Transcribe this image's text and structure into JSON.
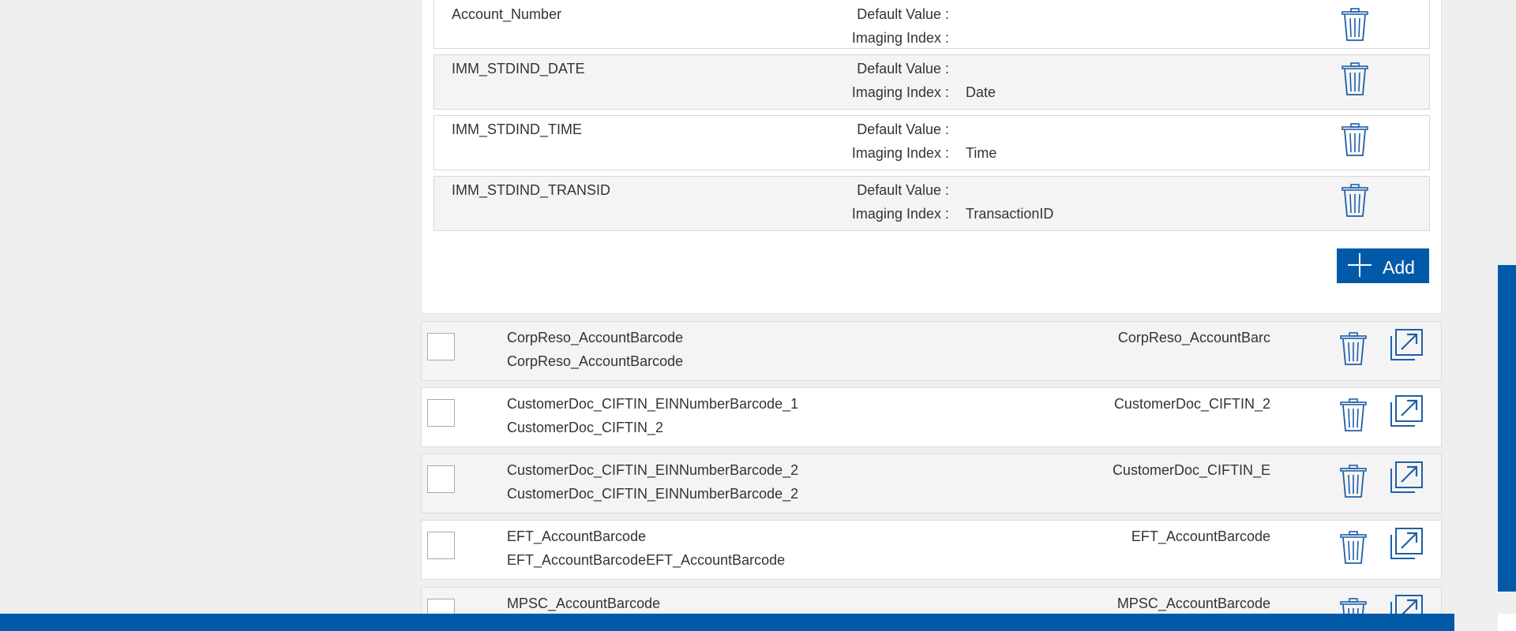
{
  "index_fields": [
    {
      "name": "Account_Number",
      "default_label": "Default Value :",
      "imaging_label": "Imaging Index :",
      "imaging_value": ""
    },
    {
      "name": "IMM_STDIND_DATE",
      "default_label": "Default Value :",
      "imaging_label": "Imaging Index :",
      "imaging_value": "Date"
    },
    {
      "name": "IMM_STDIND_TIME",
      "default_label": "Default Value :",
      "imaging_label": "Imaging Index :",
      "imaging_value": "Time"
    },
    {
      "name": "IMM_STDIND_TRANSID",
      "default_label": "Default Value :",
      "imaging_label": "Imaging Index :",
      "imaging_value": "TransactionID"
    }
  ],
  "add_button": {
    "label": "Add",
    "icon": "plus-icon"
  },
  "documents": [
    {
      "name": "CorpReso_AccountBarcode",
      "sub": "CorpReso_AccountBarcode",
      "right": "CorpReso_AccountBarc"
    },
    {
      "name": "CustomerDoc_CIFTIN_EINNumberBarcode_1",
      "sub": "CustomerDoc_CIFTIN_2",
      "right": "CustomerDoc_CIFTIN_2"
    },
    {
      "name": "CustomerDoc_CIFTIN_EINNumberBarcode_2",
      "sub": "CustomerDoc_CIFTIN_EINNumberBarcode_2",
      "right": "CustomerDoc_CIFTIN_E"
    },
    {
      "name": "EFT_AccountBarcode",
      "sub": "EFT_AccountBarcodeEFT_AccountBarcode",
      "right": "EFT_AccountBarcode"
    },
    {
      "name": "MPSC_AccountBarcode",
      "sub": "",
      "right": "MPSC_AccountBarcode"
    }
  ],
  "icons": {
    "delete": "trash-icon",
    "open": "open-external-icon"
  },
  "colors": {
    "accent": "#005aa8",
    "row_grey": "#f4f4f4",
    "page_bg": "#efefef"
  }
}
